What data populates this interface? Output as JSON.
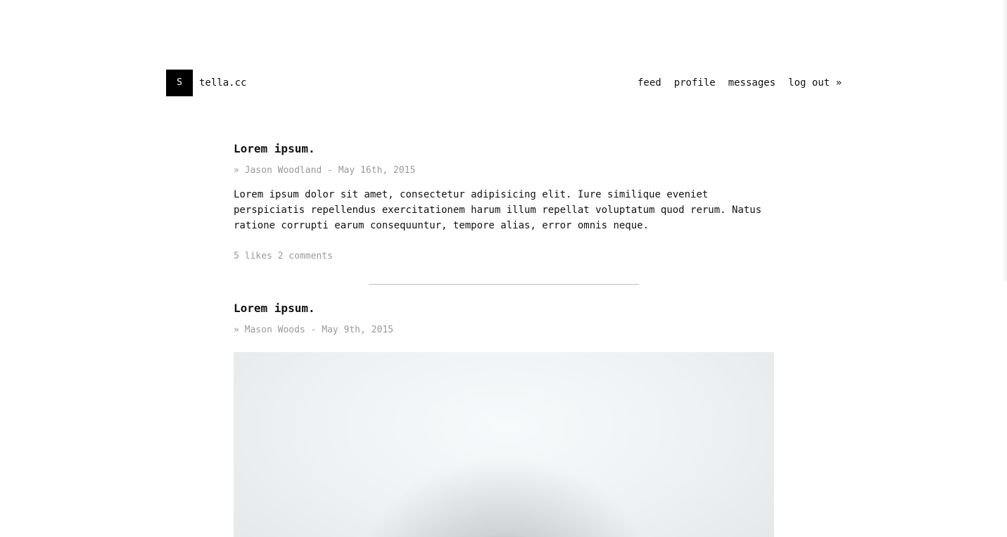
{
  "header": {
    "logo_letter": "S",
    "site_name": "tella.cc",
    "nav": [
      {
        "label": "feed"
      },
      {
        "label": "profile"
      },
      {
        "label": "messages"
      },
      {
        "label": "log out »"
      }
    ]
  },
  "posts": [
    {
      "title": "Lorem ipsum.",
      "meta": "» Jason Woodland - May 16th, 2015",
      "body": "Lorem ipsum dolor sit amet, consectetur adipisicing elit. Iure similique eveniet perspiciatis repellendus exercitationem harum illum repellat voluptatum quod rerum. Natus ratione corrupti earum consequuntur, tempore alias, error omnis neque.",
      "likes": "5 likes",
      "comments": "2 comments"
    },
    {
      "title": "Lorem ipsum.",
      "meta": "» Mason Woods - May 9th, 2015"
    }
  ]
}
